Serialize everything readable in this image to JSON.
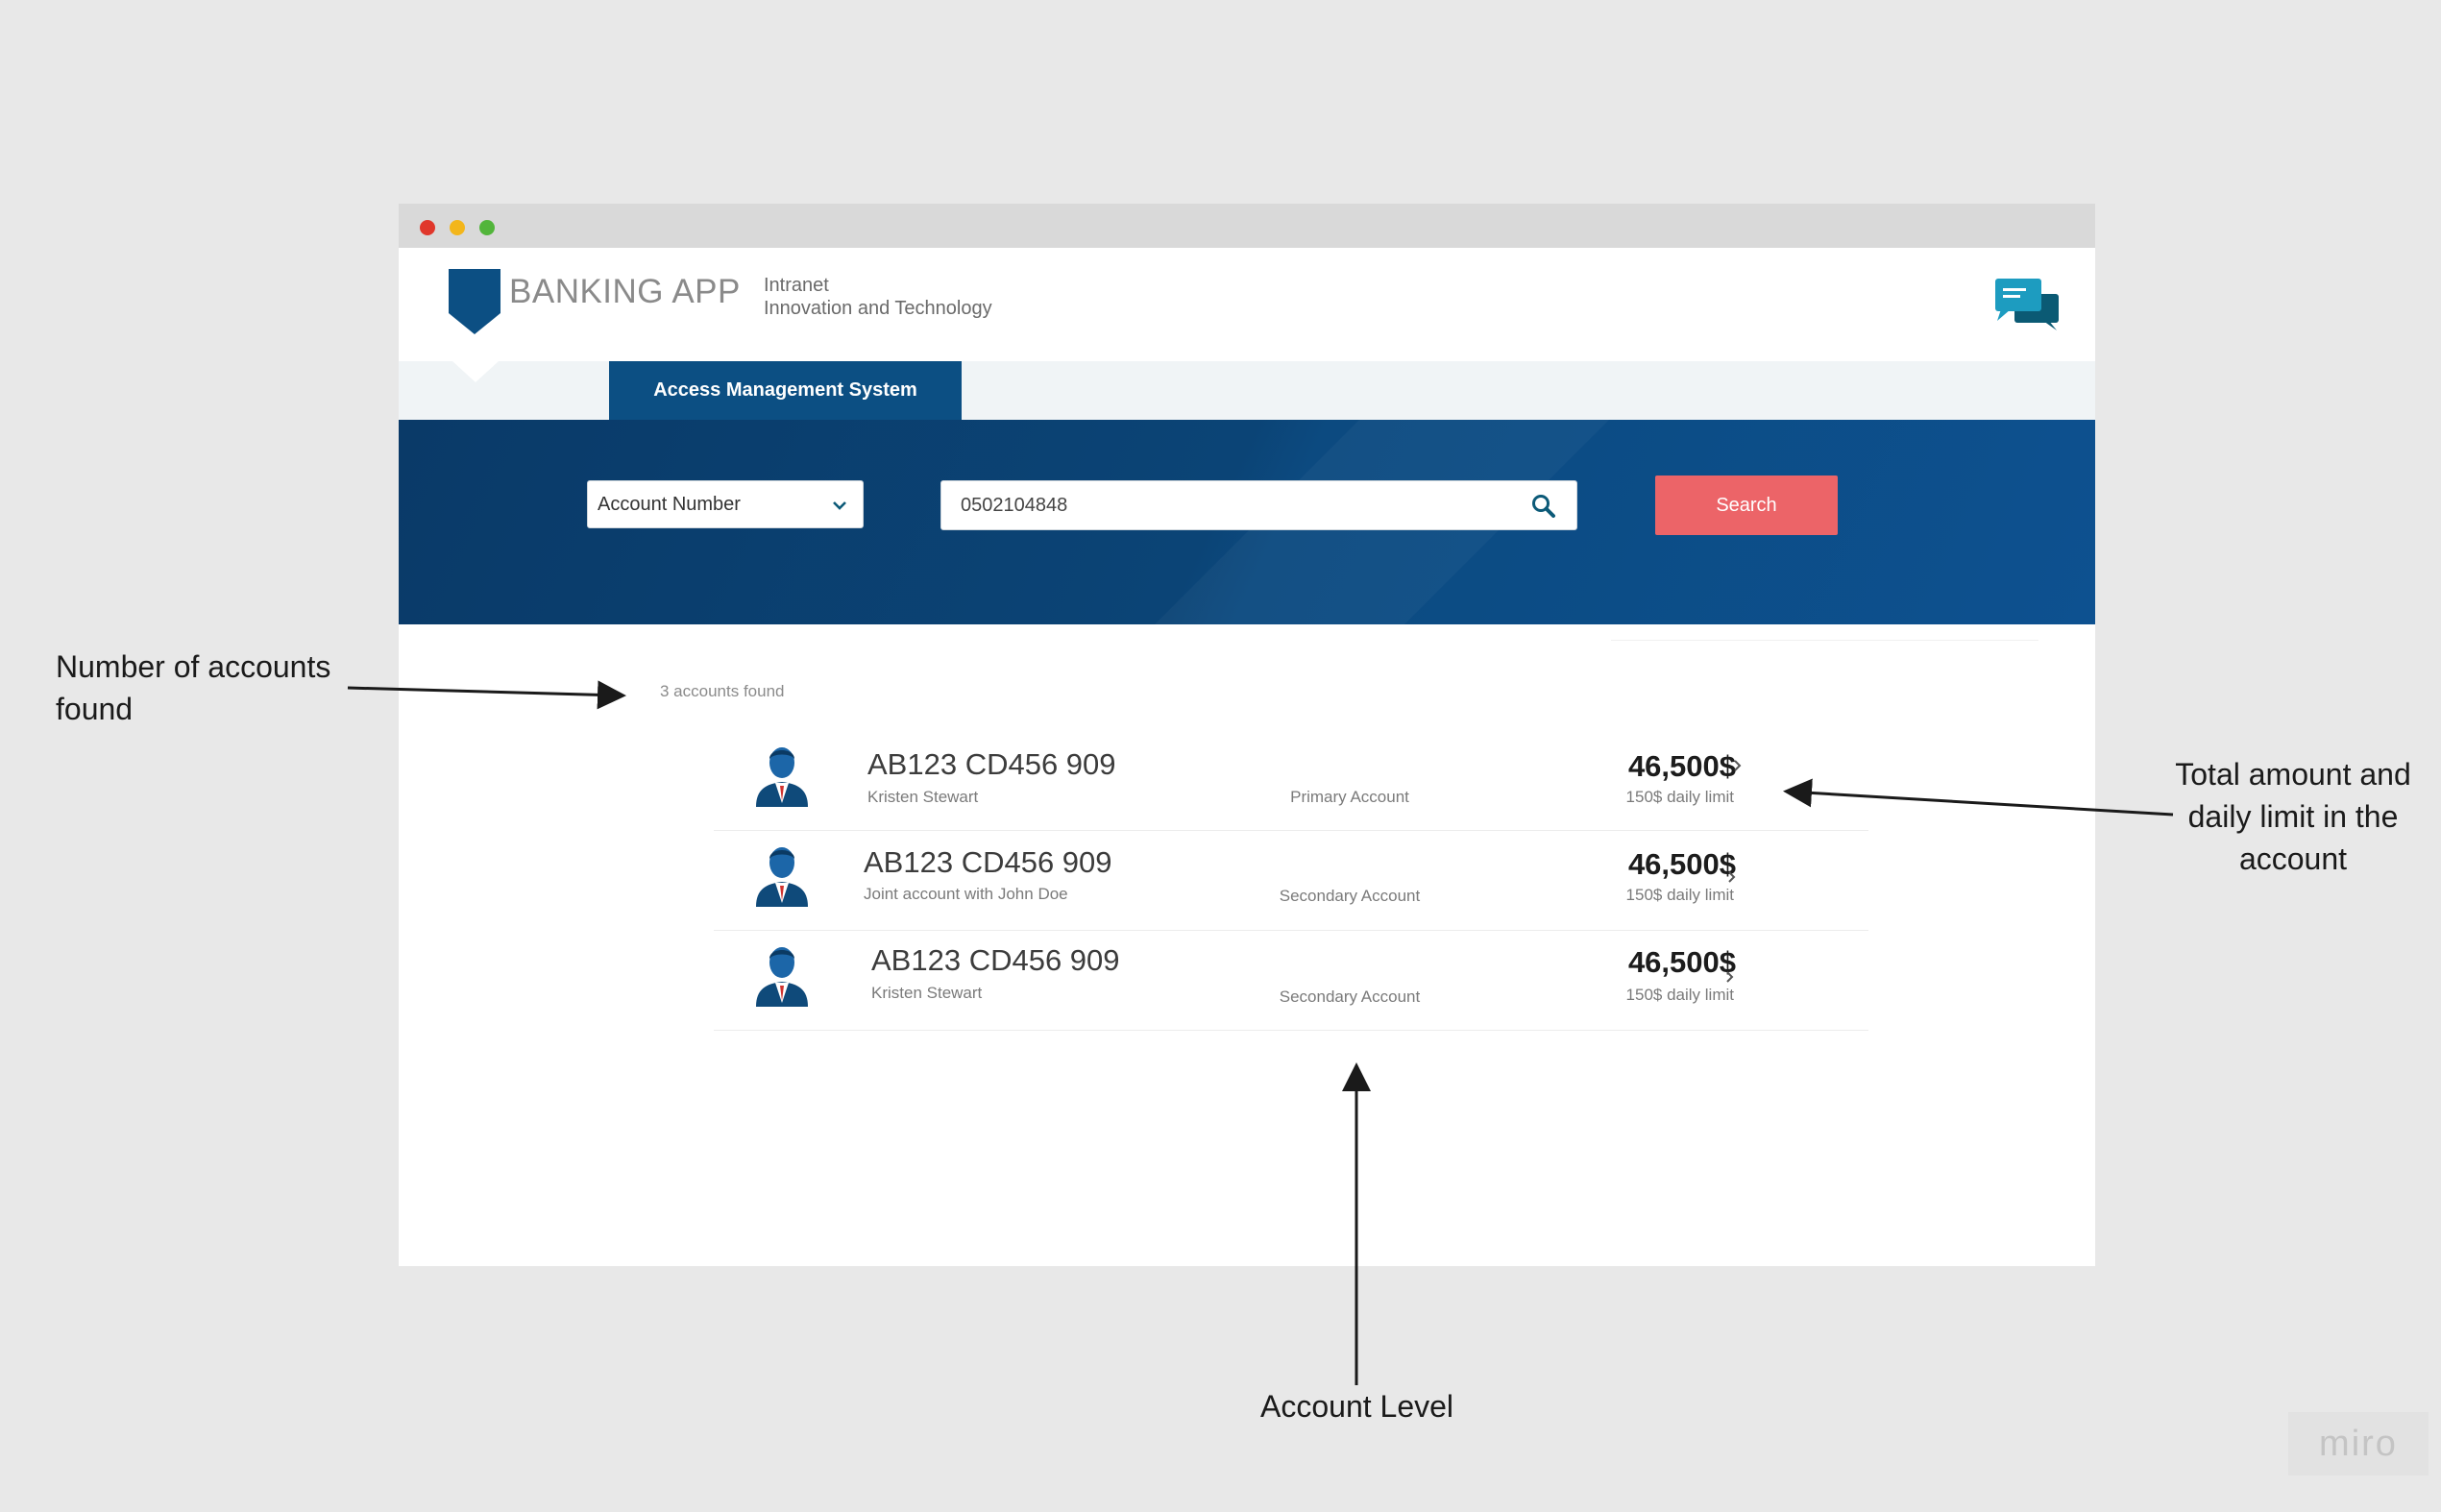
{
  "app": {
    "title": "BANKING APP",
    "subtitle_line1": "Intranet",
    "subtitle_line2": "Innovation and Technology"
  },
  "nav": {
    "active_tab": "Access Management System"
  },
  "search": {
    "filter_selected": "Account Number",
    "query_value": "0502104848",
    "button_label": "Search"
  },
  "results": {
    "count_text": "3 accounts found",
    "rows": [
      {
        "account_number": "AB123 CD456 909",
        "owner": "Kristen Stewart",
        "level": "Primary Account",
        "amount": "46,500$",
        "daily_limit": "150$ daily limit"
      },
      {
        "account_number": "AB123 CD456 909",
        "owner": "Joint account with John Doe",
        "level": "Secondary Account",
        "amount": "46,500$",
        "daily_limit": "150$ daily limit"
      },
      {
        "account_number": "AB123 CD456 909",
        "owner": "Kristen Stewart",
        "level": "Secondary Account",
        "amount": "46,500$",
        "daily_limit": "150$ daily limit"
      }
    ]
  },
  "annotations": {
    "accounts_found": "Number of accounts found",
    "total_amount": "Total amount and daily limit in the account",
    "account_level": "Account Level"
  },
  "watermark": "miro",
  "colors": {
    "brand_blue": "#0c4f83",
    "search_button": "#ec6468",
    "background": "#e8e8e8"
  },
  "icons": [
    "shield-logo-icon",
    "chat-bubbles-icon",
    "chevron-down-icon",
    "search-icon",
    "user-avatar-icon",
    "chevron-right-icon"
  ]
}
